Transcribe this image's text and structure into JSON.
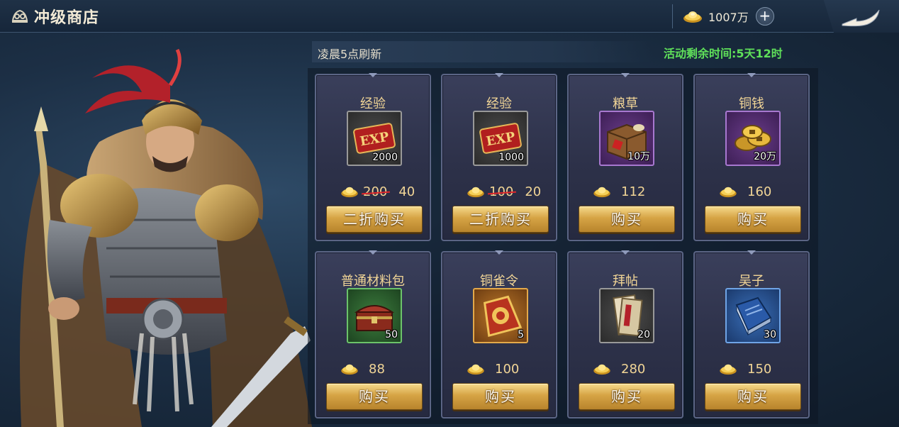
{
  "header": {
    "title": "冲级商店",
    "currency_value": "1007万",
    "add_label": "+"
  },
  "shop": {
    "refresh_text": "凌晨5点刷新",
    "timer_text": "活动剩余时间:5天12时"
  },
  "items": [
    {
      "name": "经验",
      "qty": "2000",
      "old_price": "200",
      "price": "40",
      "button": "二折购买",
      "frame": "grey",
      "icon": "exp-scroll-icon"
    },
    {
      "name": "经验",
      "qty": "1000",
      "old_price": "100",
      "price": "20",
      "button": "二折购买",
      "frame": "grey",
      "icon": "exp-scroll-icon"
    },
    {
      "name": "粮草",
      "qty": "10万",
      "price": "112",
      "button": "购买",
      "frame": "purple",
      "icon": "grain-crate-icon"
    },
    {
      "name": "铜钱",
      "qty": "20万",
      "price": "160",
      "button": "购买",
      "frame": "purple",
      "icon": "copper-coins-icon"
    },
    {
      "name": "普通材料包",
      "qty": "50",
      "price": "88",
      "button": "购买",
      "frame": "green",
      "icon": "treasure-chest-icon"
    },
    {
      "name": "铜雀令",
      "qty": "5",
      "price": "100",
      "button": "购买",
      "frame": "orange",
      "icon": "bronze-token-icon"
    },
    {
      "name": "拜帖",
      "qty": "20",
      "price": "280",
      "button": "购买",
      "frame": "grey",
      "icon": "invitation-card-icon"
    },
    {
      "name": "吴子",
      "qty": "30",
      "price": "150",
      "button": "购买",
      "frame": "blue",
      "icon": "blue-book-icon"
    }
  ],
  "colors": {
    "timer_green": "#5fe05a",
    "price_gold": "#f1d596",
    "strike_red": "#e0262a"
  }
}
